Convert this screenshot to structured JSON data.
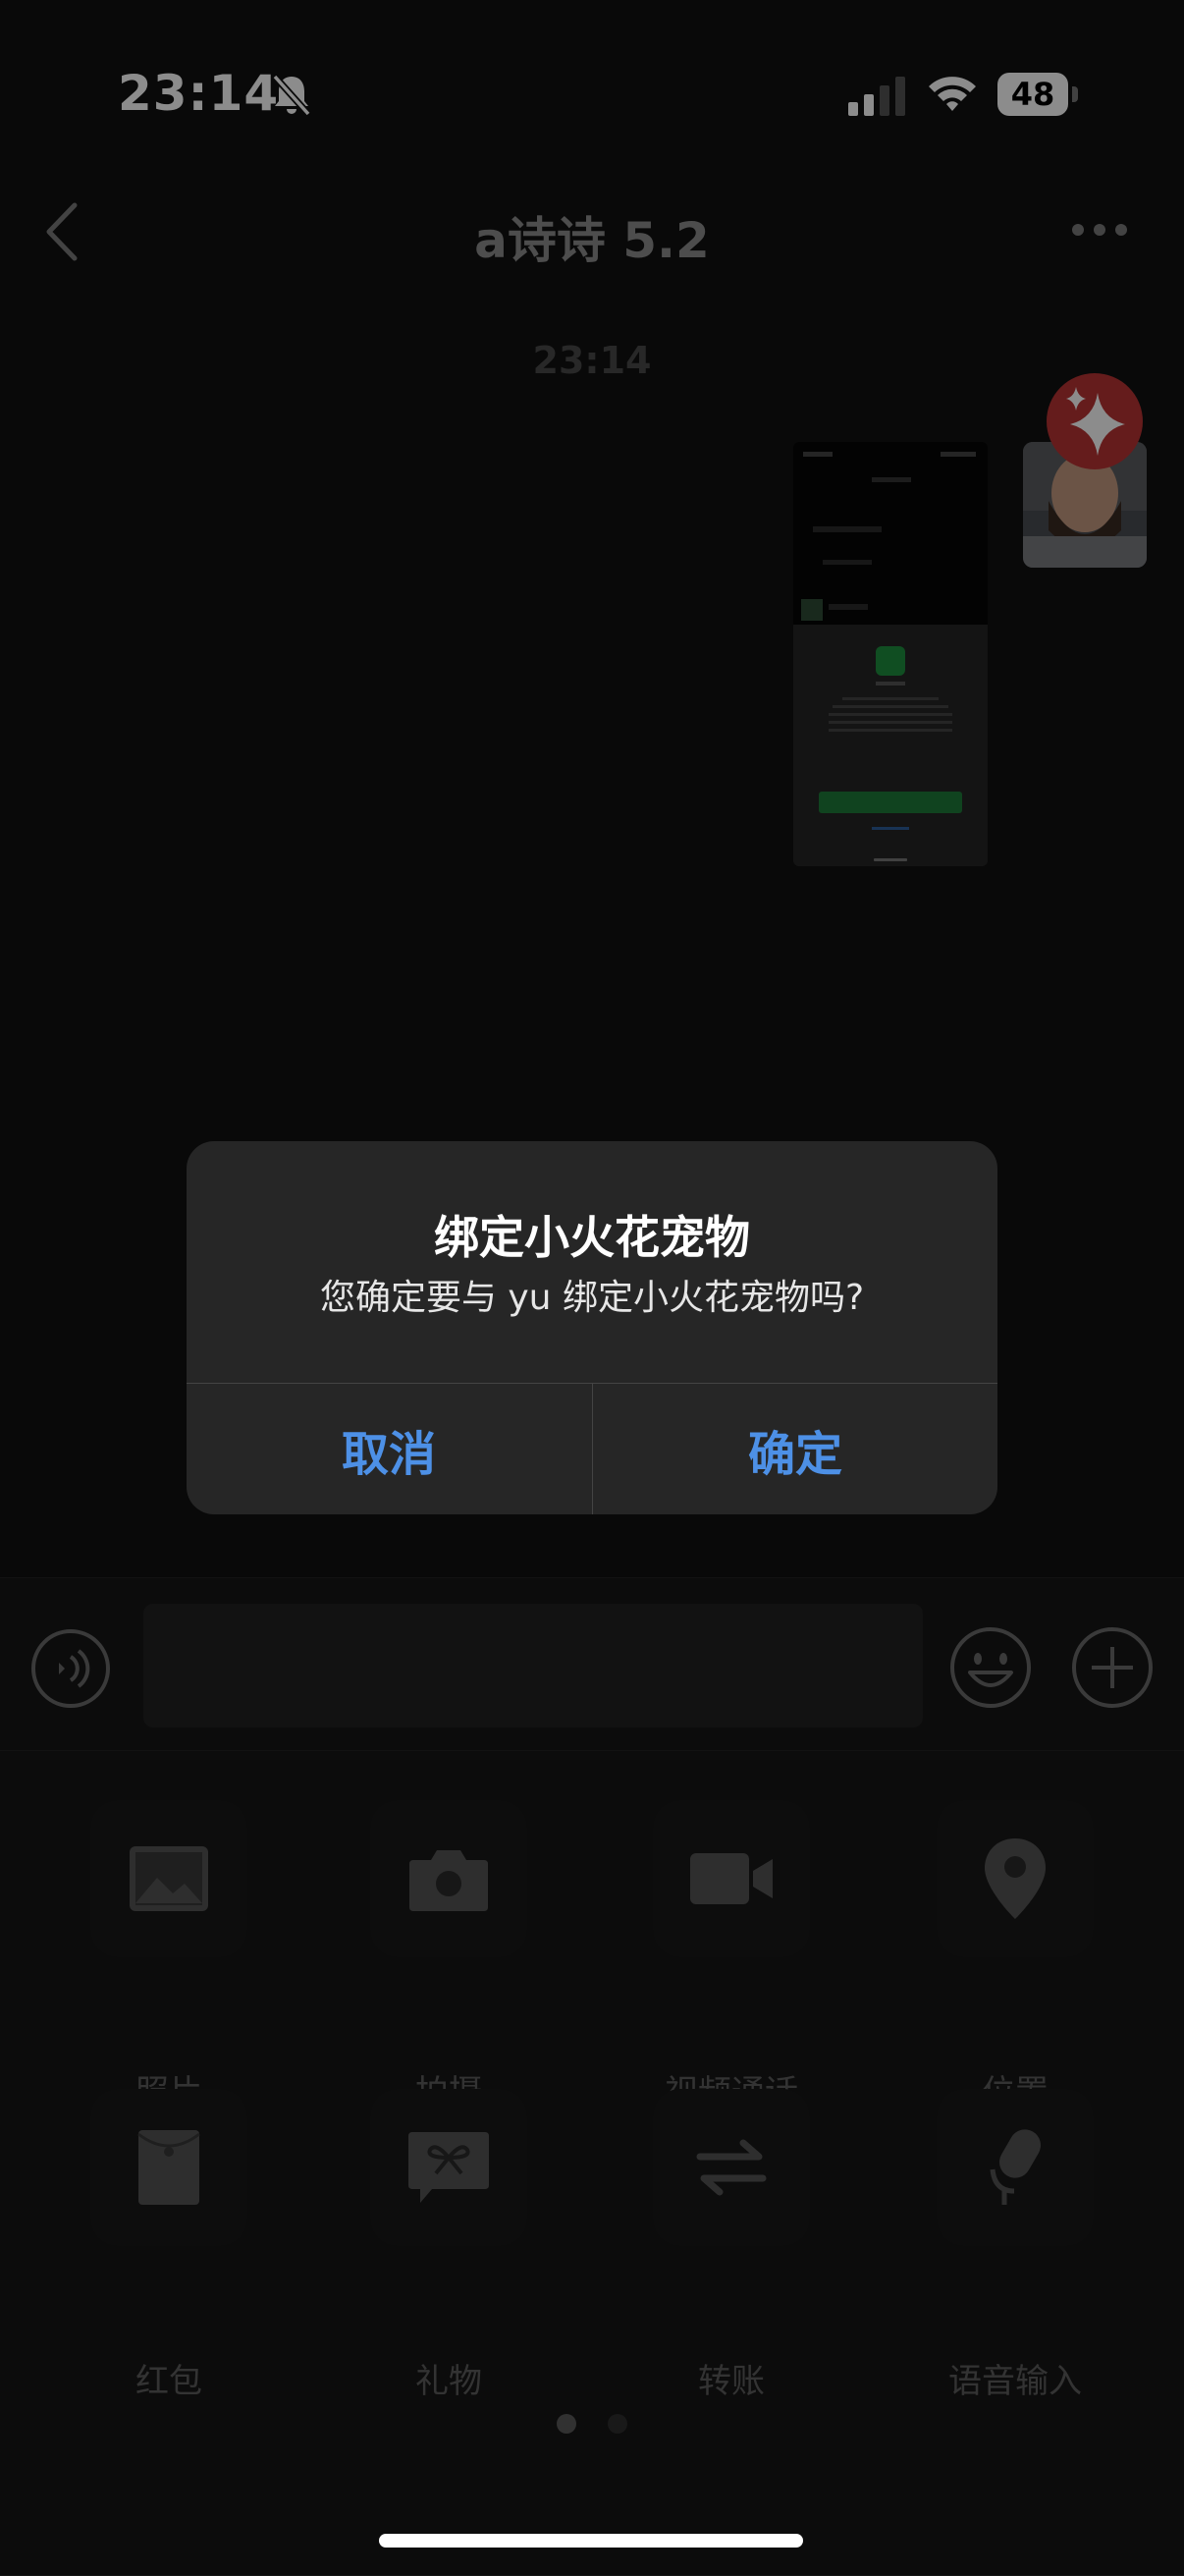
{
  "status_bar": {
    "time": "23:14",
    "battery": "48"
  },
  "nav": {
    "title": "a诗诗 5.2"
  },
  "chat": {
    "time_separator": "23:14"
  },
  "dialog": {
    "title": "绑定小火花宠物",
    "message": "您确定要与 yu 绑定小火花宠物吗?",
    "cancel_label": "取消",
    "confirm_label": "确定"
  },
  "panel": {
    "items": [
      {
        "label": "照片",
        "icon": "photo-icon"
      },
      {
        "label": "拍摄",
        "icon": "camera-icon"
      },
      {
        "label": "视频通话",
        "icon": "video-call-icon"
      },
      {
        "label": "位置",
        "icon": "location-icon"
      },
      {
        "label": "红包",
        "icon": "red-packet-icon"
      },
      {
        "label": "礼物",
        "icon": "gift-icon"
      },
      {
        "label": "转账",
        "icon": "transfer-icon"
      },
      {
        "label": "语音输入",
        "icon": "microphone-icon"
      }
    ],
    "page_indicator": {
      "pages": 2,
      "current": 1
    }
  },
  "colors": {
    "accent": "#4d90e6",
    "background": "#111111",
    "dialog": "#262626"
  }
}
